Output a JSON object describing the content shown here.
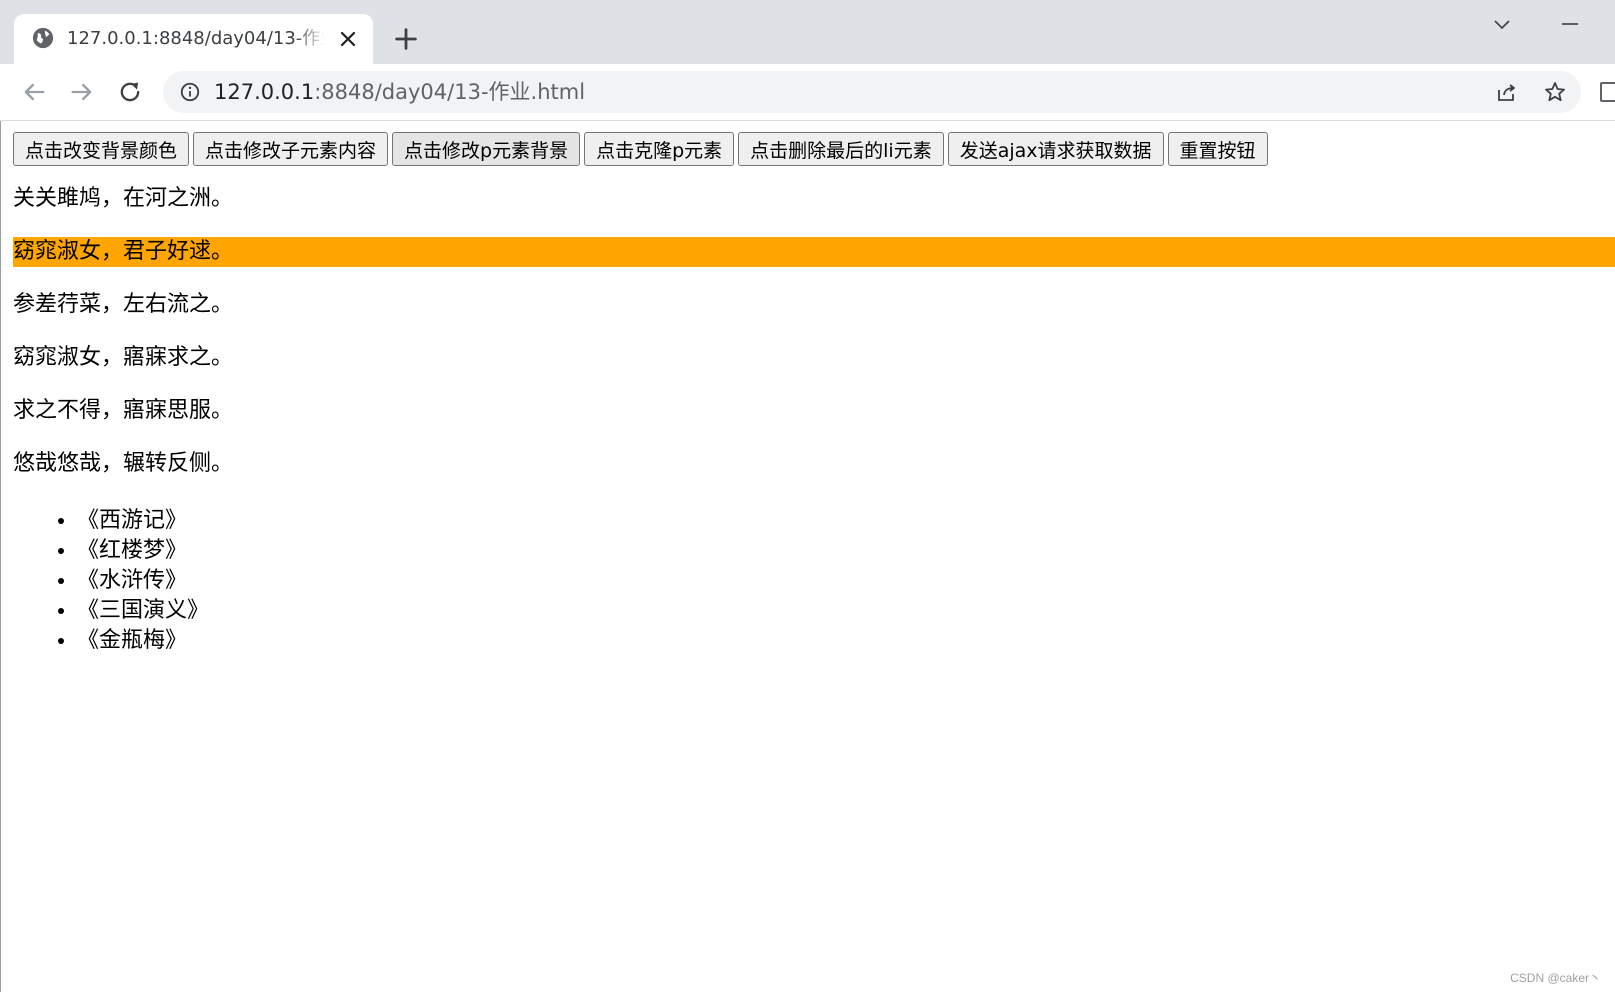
{
  "browser": {
    "tab": {
      "title": "127.0.0.1:8848/day04/13-作业.html"
    },
    "address": {
      "host": "127.0.0.1",
      "rest": ":8848/day04/13-作业.html"
    }
  },
  "toolbar_buttons": [
    "点击改变背景颜色",
    "点击修改子元素内容",
    "点击修改p元素背景",
    "点击克隆p元素",
    "点击删除最后的li元素",
    "发送ajax请求获取数据",
    "重置按钮"
  ],
  "paragraphs": [
    "关关雎鸠，在河之洲。",
    "窈窕淑女，君子好逑。",
    "参差荇菜，左右流之。",
    "窈窕淑女，寤寐求之。",
    "求之不得，寤寐思服。",
    "悠哉悠哉，辗转反侧。"
  ],
  "highlight_color": "#ffa500",
  "books": [
    "《西游记》",
    "《红楼梦》",
    "《水浒传》",
    "《三国演义》",
    "《金瓶梅》"
  ],
  "watermark": "CSDN @caker丶"
}
